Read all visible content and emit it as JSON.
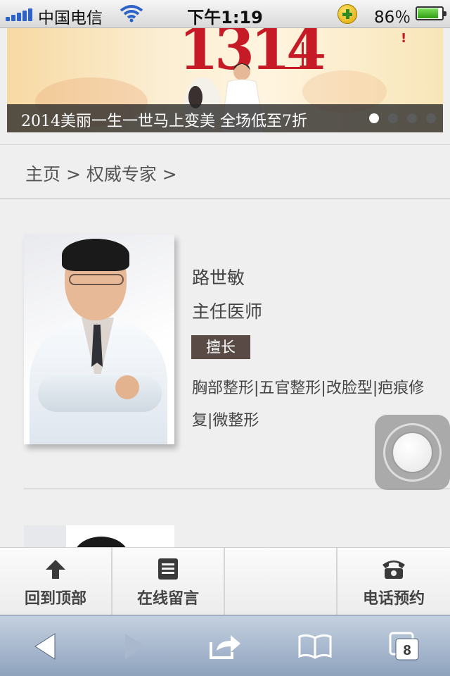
{
  "status_bar": {
    "carrier": "中国电信",
    "time": "下午1:19",
    "battery_percent": "86％",
    "battery_level": 0.86
  },
  "banner": {
    "number_text": "1314",
    "caption": "2014美丽一生一世马上变美 全场低至7折",
    "dots": 4,
    "active_dot": 0
  },
  "breadcrumb": {
    "text": "主页 > 权威专家 >"
  },
  "doctor": {
    "name": "路世敏",
    "title": "主任医师",
    "specialty_label": "擅长",
    "specialties": "胸部整形|五官整形|改脸型|疤痕修复|微整形"
  },
  "bottom_nav": {
    "back_to_top": "回到顶部",
    "message": "在线留言",
    "phone": "电话预约"
  },
  "browser": {
    "tabs_count": "8"
  },
  "colors": {
    "accent_dark": "#5a4a45",
    "banner_red": "#c61b26",
    "toolbar_blue": "#8fa3be"
  }
}
